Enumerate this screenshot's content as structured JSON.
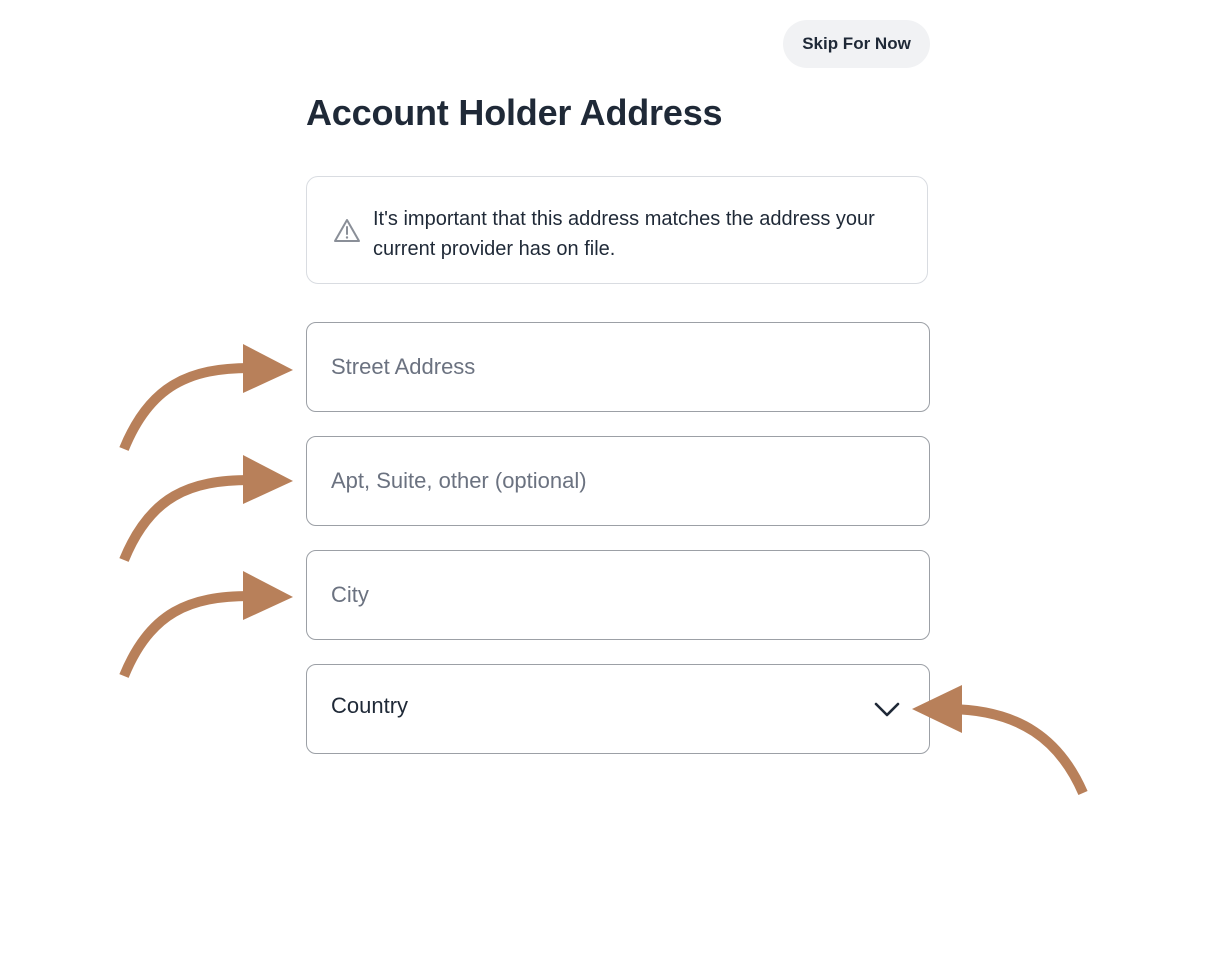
{
  "header": {
    "skip_label": "Skip For Now"
  },
  "main": {
    "title": "Account Holder Address",
    "notice": {
      "icon": "warning-triangle-icon",
      "text": "It's important that this address matches the address your current provider has on file."
    },
    "fields": {
      "street_placeholder": "Street Address",
      "apt_placeholder": "Apt, Suite, other (optional)",
      "city_placeholder": "City",
      "country_value": "Country",
      "country_icon": "chevron-down-icon"
    }
  },
  "annotations": {
    "arrow_color": "#b8805a",
    "arrow_count": 4
  },
  "colors": {
    "text": "#1f2937",
    "placeholder": "#6b7280",
    "skip_bg": "#f1f2f4",
    "border": "#9ca0a6"
  }
}
